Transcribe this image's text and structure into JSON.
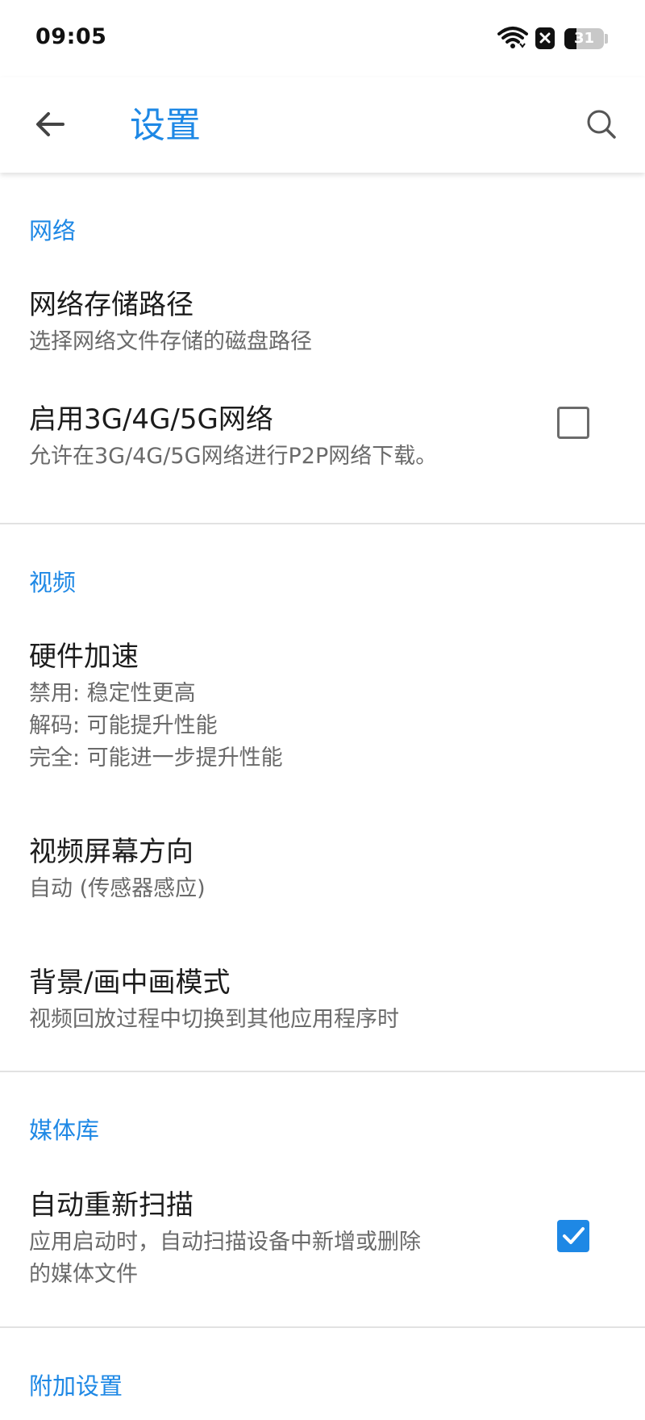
{
  "status_bar": {
    "time": "09:05",
    "battery_level": "31",
    "battery_fraction": 0.31,
    "icons": [
      "wifi-icon",
      "notification-x-icon",
      "battery-icon"
    ]
  },
  "app_bar": {
    "title": "设置",
    "back_icon": "arrow-left-icon",
    "search_icon": "search-icon"
  },
  "colors": {
    "accent": "#1e88e5",
    "primary_text": "#1c1c1c",
    "secondary_text": "#6a6a6a",
    "divider": "#e2e2e2"
  },
  "sections": [
    {
      "header": "网络",
      "items": [
        {
          "title": "网络存储路径",
          "summary": [
            "选择网络文件存储的磁盘路径"
          ]
        },
        {
          "title": "启用3G/4G/5G网络",
          "summary": [
            "允许在3G/4G/5G网络进行P2P网络下载。"
          ],
          "checkbox": false
        }
      ]
    },
    {
      "header": "视频",
      "items": [
        {
          "title": "硬件加速",
          "summary": [
            "禁用: 稳定性更高",
            "解码: 可能提升性能",
            "完全: 可能进一步提升性能"
          ]
        },
        {
          "title": "视频屏幕方向",
          "summary": [
            "自动 (传感器感应)"
          ]
        },
        {
          "title": "背景/画中画模式",
          "summary": [
            "视频回放过程中切换到其他应用程序时"
          ]
        }
      ]
    },
    {
      "header": "媒体库",
      "items": [
        {
          "title": "自动重新扫描",
          "summary": [
            "应用启动时，自动扫描设备中新增或删除",
            "的媒体文件"
          ],
          "checkbox": true
        }
      ]
    },
    {
      "header": "附加设置",
      "items": []
    }
  ]
}
